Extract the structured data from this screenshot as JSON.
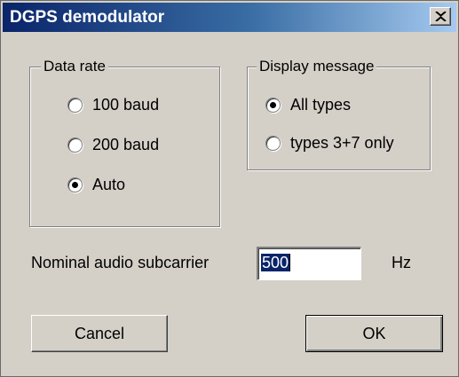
{
  "window": {
    "title": "DGPS demodulator",
    "close_icon": "close-x-icon",
    "titlebar_colors": [
      "#0a246a",
      "#a6caf0"
    ]
  },
  "data_rate": {
    "legend": "Data rate",
    "options": [
      {
        "label": "100 baud",
        "checked": false
      },
      {
        "label": "200 baud",
        "checked": false
      },
      {
        "label": "Auto",
        "checked": true
      }
    ]
  },
  "display_message": {
    "legend": "Display message",
    "options": [
      {
        "label": "All types",
        "checked": true
      },
      {
        "label": "types 3+7 only",
        "checked": false
      }
    ]
  },
  "subcarrier": {
    "label": "Nominal audio subcarrier",
    "value": "500",
    "unit": "Hz"
  },
  "buttons": {
    "cancel": "Cancel",
    "ok": "OK"
  }
}
